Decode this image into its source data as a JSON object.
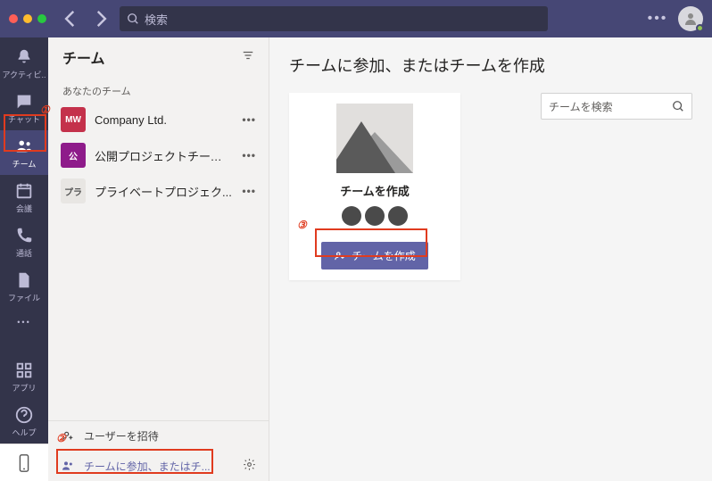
{
  "titlebar": {
    "search_placeholder": "検索",
    "traffic": [
      "#ff5f57",
      "#febc2e",
      "#28c840"
    ]
  },
  "rail": {
    "items": [
      {
        "label": "アクティビ..",
        "icon": "bell"
      },
      {
        "label": "チャット",
        "icon": "chat"
      },
      {
        "label": "チーム",
        "icon": "teams",
        "active": true
      },
      {
        "label": "会議",
        "icon": "calendar"
      },
      {
        "label": "通話",
        "icon": "call"
      },
      {
        "label": "ファイル",
        "icon": "file"
      },
      {
        "label": "",
        "icon": "dots"
      }
    ],
    "bottom": [
      {
        "label": "アプリ",
        "icon": "apps"
      },
      {
        "label": "ヘルプ",
        "icon": "help"
      }
    ]
  },
  "sidebar": {
    "title": "チーム",
    "section": "あなたのチーム",
    "teams": [
      {
        "avatar": "MW",
        "color": "#c4314b",
        "name": "Company Ltd."
      },
      {
        "avatar": "公",
        "color": "#8e1b8a",
        "name": "公開プロジェクトチーム一般"
      },
      {
        "avatar": "プラ",
        "color": "#e8e6e3",
        "fg": "#555",
        "name": "プライベートプロジェク..."
      }
    ],
    "invite": "ユーザーを招待",
    "join": "チームに参加、またはチ..."
  },
  "main": {
    "title": "チームに参加、またはチームを作成",
    "card_title": "チームを作成",
    "create_btn": "チームを作成",
    "search_placeholder": "チームを検索"
  },
  "annotations": {
    "a1": "①",
    "a2": "②",
    "a3": "③"
  }
}
